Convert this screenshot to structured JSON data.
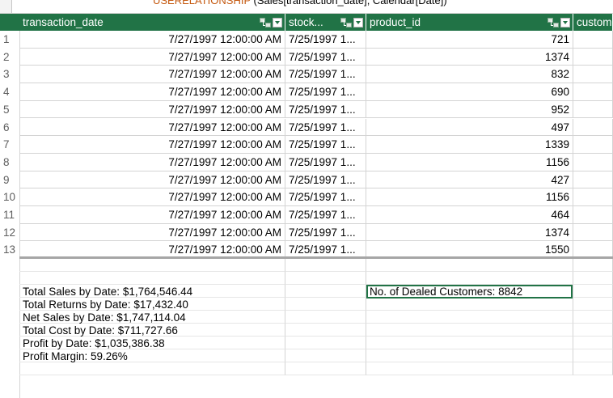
{
  "formula_bar": {
    "function_name": "USERELATIONSHIP",
    "arguments": " (Sales[transaction_date], Calendar[Date])"
  },
  "columns": [
    {
      "label": "transaction_date"
    },
    {
      "label": "stock..."
    },
    {
      "label": "product_id"
    },
    {
      "label": "custom"
    }
  ],
  "icons": {
    "relationship": "relationship-icon",
    "filter": "filter-dropdown-icon"
  },
  "rows": [
    {
      "num": "1",
      "transaction_date": "7/27/1997 12:00:00 AM",
      "stock": "7/25/1997 1...",
      "product_id": "721"
    },
    {
      "num": "2",
      "transaction_date": "7/27/1997 12:00:00 AM",
      "stock": "7/25/1997 1...",
      "product_id": "1374"
    },
    {
      "num": "3",
      "transaction_date": "7/27/1997 12:00:00 AM",
      "stock": "7/25/1997 1...",
      "product_id": "832"
    },
    {
      "num": "4",
      "transaction_date": "7/27/1997 12:00:00 AM",
      "stock": "7/25/1997 1...",
      "product_id": "690"
    },
    {
      "num": "5",
      "transaction_date": "7/27/1997 12:00:00 AM",
      "stock": "7/25/1997 1...",
      "product_id": "952"
    },
    {
      "num": "6",
      "transaction_date": "7/27/1997 12:00:00 AM",
      "stock": "7/25/1997 1...",
      "product_id": "497"
    },
    {
      "num": "7",
      "transaction_date": "7/27/1997 12:00:00 AM",
      "stock": "7/25/1997 1...",
      "product_id": "1339"
    },
    {
      "num": "8",
      "transaction_date": "7/27/1997 12:00:00 AM",
      "stock": "7/25/1997 1...",
      "product_id": "1156"
    },
    {
      "num": "9",
      "transaction_date": "7/27/1997 12:00:00 AM",
      "stock": "7/25/1997 1...",
      "product_id": "427"
    },
    {
      "num": "10",
      "transaction_date": "7/27/1997 12:00:00 AM",
      "stock": "7/25/1997 1...",
      "product_id": "1156"
    },
    {
      "num": "11",
      "transaction_date": "7/27/1997 12:00:00 AM",
      "stock": "7/25/1997 1...",
      "product_id": "464"
    },
    {
      "num": "12",
      "transaction_date": "7/27/1997 12:00:00 AM",
      "stock": "7/25/1997 1...",
      "product_id": "1374"
    },
    {
      "num": "13",
      "transaction_date": "7/27/1997 12:00:00 AM",
      "stock": "7/25/1997 1...",
      "product_id": "1550"
    }
  ],
  "measures": [
    "Total Sales by Date: $1,764,546.44",
    "Total Returns by Date: $17,432.40",
    "Net Sales by Date: $1,747,114.04",
    "Total Cost by Date: $711,727.66",
    "Profit by Date: $1,035,386.38",
    "Profit Margin: 59.26%"
  ],
  "selected_measure": "No. of Dealed Customers: 8842",
  "colors": {
    "header_bg": "#217346",
    "header_text": "#ffffff",
    "selection_border": "#217346"
  }
}
